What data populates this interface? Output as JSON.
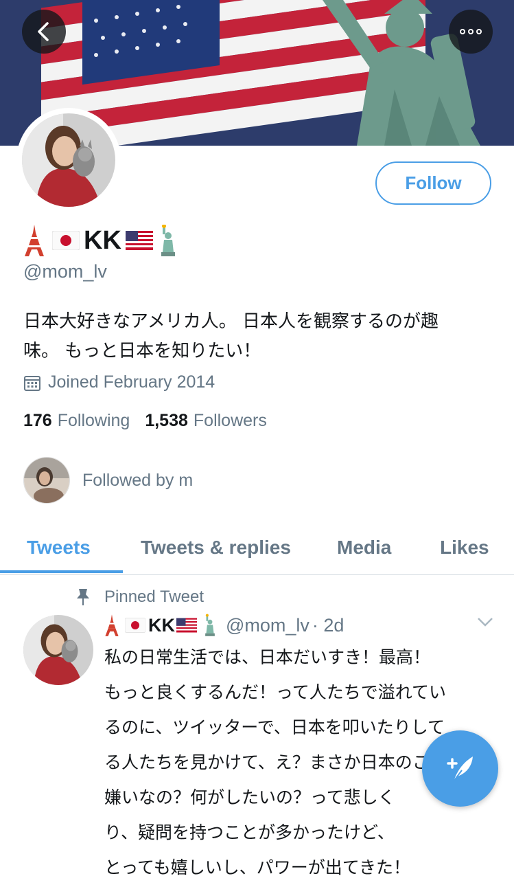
{
  "header": {
    "back_icon": "chevron-left-icon",
    "more_icon": "more-dots-icon"
  },
  "profile": {
    "name": "KK",
    "handle": "@mom_lv",
    "follow_label": "Follow",
    "bio_line1": "日本大好きなアメリカ人。 日本人を観察するのが趣",
    "bio_line2": "味。 もっと日本を知りたい！",
    "joined": "Joined February 2014",
    "following_count": "176",
    "following_label": "Following",
    "followers_count": "1,538",
    "followers_label": "Followers",
    "followed_by": "Followed by m"
  },
  "tabs": [
    {
      "label": "Tweets",
      "active": true
    },
    {
      "label": "Tweets & replies",
      "active": false
    },
    {
      "label": "Media",
      "active": false
    },
    {
      "label": "Likes",
      "active": false
    }
  ],
  "pinned_tweet": {
    "pinned_label": "Pinned Tweet",
    "author_name": "KK",
    "author_handle": "@mom_lv",
    "time": "· 2d",
    "lines": [
      "私の日常生活では、日本だいすき！最高！",
      "もっと良くするんだ！って人たちで溢れてい",
      "るのに、ツイッターで、日本を叩いたりして",
      "る人たちを見かけて、え？まさか日本のこと",
      "嫌いなの？何がしたいの？って悲しく",
      "り、疑問を持つことが多かったけど、",
      "とっても嬉しいし、パワーが出てきた！"
    ]
  },
  "colors": {
    "accent": "#4a9ee6",
    "secondary_text": "#657786"
  }
}
